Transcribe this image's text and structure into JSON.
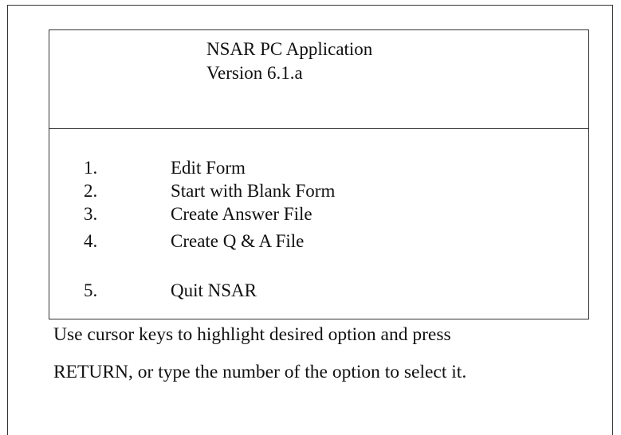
{
  "header": {
    "title": "NSAR PC Application",
    "version": "Version 6.1.a"
  },
  "menu": {
    "options": [
      {
        "number": "1.",
        "label": "Edit Form"
      },
      {
        "number": "2.",
        "label": "Start with Blank Form"
      },
      {
        "number": "3.",
        "label": "Create Answer File"
      },
      {
        "number": "4.",
        "label": "Create Q & A File"
      },
      {
        "number": "5.",
        "label": "Quit NSAR"
      }
    ]
  },
  "instructions": {
    "line1": "Use cursor keys to highlight desired option and press",
    "line2": "RETURN, or type the number of the option to select it."
  },
  "colors": {
    "text": "#111111",
    "border": "#333333",
    "background": "#ffffff"
  }
}
